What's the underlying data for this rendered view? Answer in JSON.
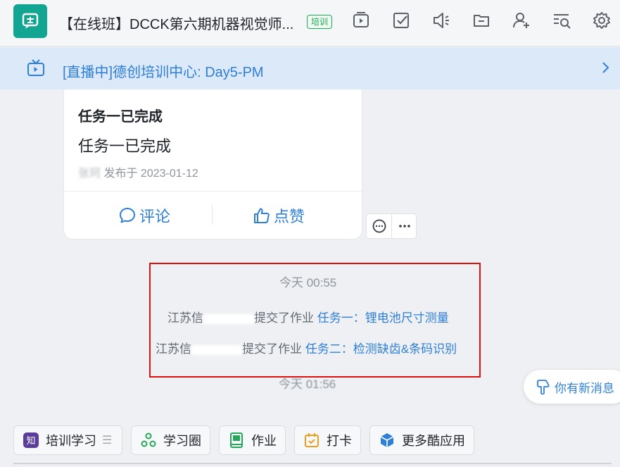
{
  "header": {
    "title": "【在线班】DCCK第六期机器视觉师...",
    "badge": "培训",
    "tools": [
      "video-icon",
      "checkbox-icon",
      "speaker-icon",
      "folder-icon",
      "add-user-icon",
      "search-list-icon",
      "gear-icon"
    ]
  },
  "live": {
    "text": "[直播中]德创培训中心: Day5-PM"
  },
  "card": {
    "title": "任务一已完成",
    "body": "任务一已完成",
    "author": "张珂",
    "published": "发布于 2023-01-12",
    "comment_label": "评论",
    "like_label": "点赞"
  },
  "messages": {
    "time_1": "今天 00:55",
    "line_1_prefix": "江苏信",
    "line_1_action": "提交了作业",
    "line_1_task": "任务一：锂电池尺寸测量",
    "line_2_prefix": "江苏信",
    "line_2_action": "提交了作业",
    "line_2_task": "任务二：检测缺齿&条码识别",
    "time_2": "今天 01:56"
  },
  "new_messages": "你有新消息",
  "apps": [
    {
      "label": "培训学习"
    },
    {
      "label": "学习圈"
    },
    {
      "label": "作业"
    },
    {
      "label": "打卡"
    },
    {
      "label": "更多酷应用"
    }
  ],
  "colors": {
    "accent": "#2f7fd8",
    "brand": "#12a592",
    "highlight": "#e01010",
    "banner": "#dbe9f9"
  }
}
